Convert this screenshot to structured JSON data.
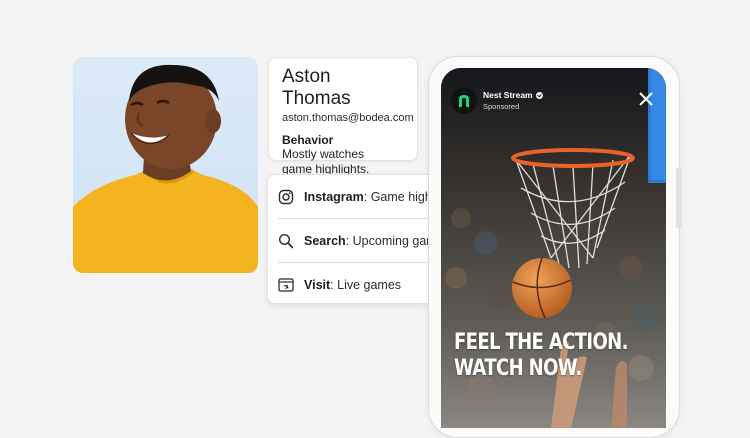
{
  "profile": {
    "name": "Aston Thomas",
    "email": "aston.thomas@bodea.com",
    "behavior_heading": "Behavior",
    "behavior_text_line1": "Mostly watches",
    "behavior_text_line2": "game highlights."
  },
  "activities": [
    {
      "icon": "instagram-icon",
      "channel": "Instagram",
      "detail": ": Game highlight"
    },
    {
      "icon": "search-icon",
      "channel": "Search",
      "detail": ": Upcoming games"
    },
    {
      "icon": "browser-visit-icon",
      "channel": "Visit",
      "detail": ": Live games"
    }
  ],
  "ad": {
    "brand": "Nest Stream",
    "label": "Sponsored",
    "headline_line1": "FEEL THE ACTION.",
    "headline_line2": "WATCH NOW."
  },
  "colors": {
    "photo_background": "#d6e7f6",
    "shirt": "#f3b41f",
    "brand_accent": "#1fd17a",
    "hoop_rim": "#e8622a"
  }
}
